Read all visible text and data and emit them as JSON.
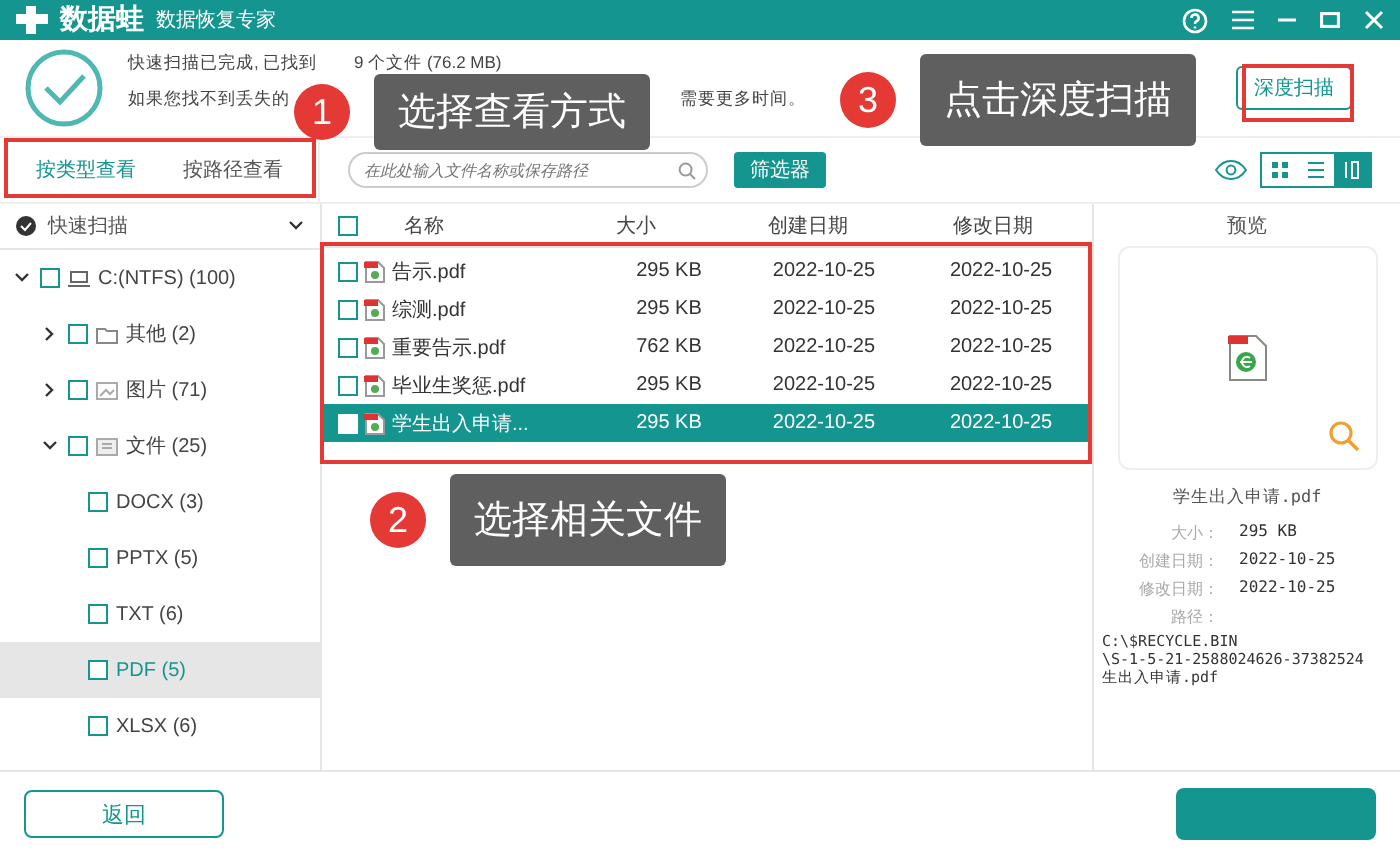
{
  "window": {
    "app_name": "数据蛙",
    "tagline": "数据恢复专家"
  },
  "status": {
    "line_1": [
      "快速扫描已完成, 已找到",
      "9 个文件 (76.2 MB)"
    ],
    "line_2": [
      "如果您找不到丢失的",
      "需要更多时间。"
    ]
  },
  "select_all": {
    "checked": false
  },
  "deep_scan_button": "深度扫描",
  "view_tabs": [
    {
      "label": "按类型查看",
      "selected": true
    },
    {
      "label": "按路径查看",
      "selected": false
    }
  ],
  "search": {
    "placeholder": "在此处输入文件名称或保存路径"
  },
  "filter_button": "筛选器",
  "view_modes": [
    {
      "kind": "grid",
      "selected": false
    },
    {
      "kind": "list",
      "selected": false
    },
    {
      "kind": "columns",
      "selected": true
    }
  ],
  "scan_selector": "快速扫描",
  "tree": [
    {
      "label": "C:(NTFS) (100)",
      "kind": "drive",
      "expanded": true,
      "selected": false,
      "children": [
        {
          "label": "其他 (2)",
          "kind": "folder",
          "expanded": false,
          "selected": false
        },
        {
          "label": "图片 (71)",
          "kind": "image",
          "expanded": false,
          "selected": false
        },
        {
          "label": "文件 (25)",
          "kind": "document",
          "expanded": true,
          "selected": false,
          "children": [
            {
              "label": "DOCX (3)",
              "kind": "leaf",
              "selected": false
            },
            {
              "label": "PPTX (5)",
              "kind": "leaf",
              "selected": false
            },
            {
              "label": "TXT (6)",
              "kind": "leaf",
              "selected": false
            },
            {
              "label": "PDF (5)",
              "kind": "leaf",
              "selected": true
            },
            {
              "label": "XLSX (6)",
              "kind": "leaf",
              "selected": false
            }
          ]
        }
      ]
    }
  ],
  "table": {
    "columns": [
      "名称",
      "大小",
      "创建日期",
      "修改日期"
    ],
    "rows": [
      {
        "name": "告示.pdf",
        "size": "295 KB",
        "created": "2022-10-25",
        "modified": "2022-10-25",
        "selected": false
      },
      {
        "name": "综测.pdf",
        "size": "295 KB",
        "created": "2022-10-25",
        "modified": "2022-10-25",
        "selected": false
      },
      {
        "name": "重要告示.pdf",
        "size": "762 KB",
        "created": "2022-10-25",
        "modified": "2022-10-25",
        "selected": false
      },
      {
        "name": "毕业生奖惩.pdf",
        "size": "295 KB",
        "created": "2022-10-25",
        "modified": "2022-10-25",
        "selected": false
      },
      {
        "name": "学生出入申请...",
        "size": "295 KB",
        "created": "2022-10-25",
        "modified": "2022-10-25",
        "selected": true
      }
    ]
  },
  "preview": {
    "title": "预览",
    "file_name": "学生出入申请.pdf",
    "fields": [
      {
        "label": "大小：",
        "value": "295 KB"
      },
      {
        "label": "创建日期：",
        "value": "2022-10-25"
      },
      {
        "label": "修改日期：",
        "value": "2022-10-25"
      }
    ],
    "path_label": "路径：",
    "path": [
      "C:\\$RECYCLE.BIN",
      "\\S-1-5-21-2588024626-37382524",
      "生出入申请.pdf"
    ]
  },
  "back_button": "返回",
  "callouts": [
    {
      "number": "1",
      "text": "选择查看方式"
    },
    {
      "number": "2",
      "text": "选择相关文件"
    },
    {
      "number": "3",
      "text": "点击深度扫描"
    }
  ]
}
